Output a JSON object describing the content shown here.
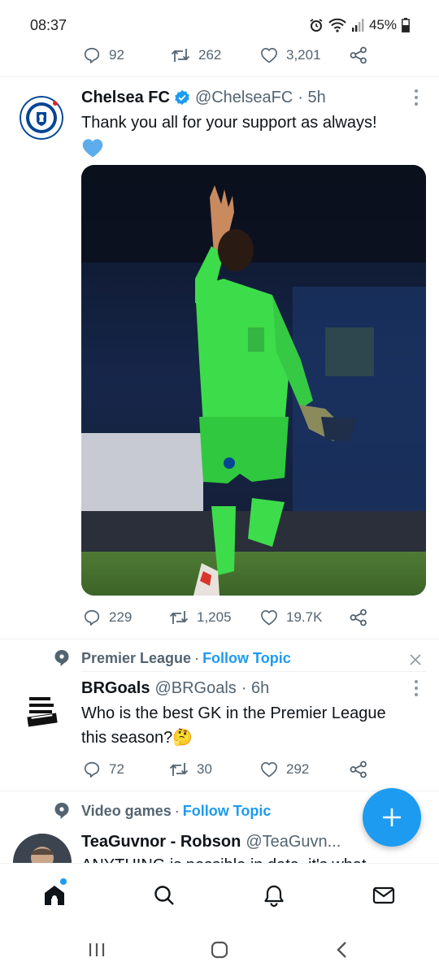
{
  "status_bar": {
    "time": "08:37",
    "battery": "45%"
  },
  "prev_tweet_actions": {
    "replies": "92",
    "retweets": "262",
    "likes": "3,201"
  },
  "tweet1": {
    "name": "Chelsea FC",
    "handle": "@ChelseaFC",
    "time": "· 5h",
    "text": "Thank you all for your support as always!",
    "actions": {
      "replies": "229",
      "retweets": "1,205",
      "likes": "19.7K"
    }
  },
  "tweet2": {
    "topic": "Premier League",
    "topic_sep": "·",
    "follow_label": "Follow Topic",
    "name": "BRGoals",
    "handle": "@BRGoals",
    "time": "· 6h",
    "text": "Who is the best GK in the Premier League this season?🤔",
    "actions": {
      "replies": "72",
      "retweets": "30",
      "likes": "292"
    }
  },
  "tweet3": {
    "topic": "Video games",
    "topic_sep": "·",
    "follow_label": "Follow Topic",
    "name": "TeaGuvnor - Robson",
    "handle": "@TeaGuvn...",
    "text": "ANYTHING is possible in data, it's what"
  },
  "colors": {
    "accent": "#1d9bf0",
    "text": "#0f1419",
    "secondary": "#536471",
    "keeper_kit": "#3ddc4a"
  },
  "icons": {
    "reply": "reply-icon",
    "retweet": "retweet-icon",
    "like": "heart-icon",
    "share": "share-icon",
    "home": "home-icon",
    "search": "search-icon",
    "notifications": "bell-icon",
    "messages": "mail-icon",
    "compose": "plus-icon"
  }
}
